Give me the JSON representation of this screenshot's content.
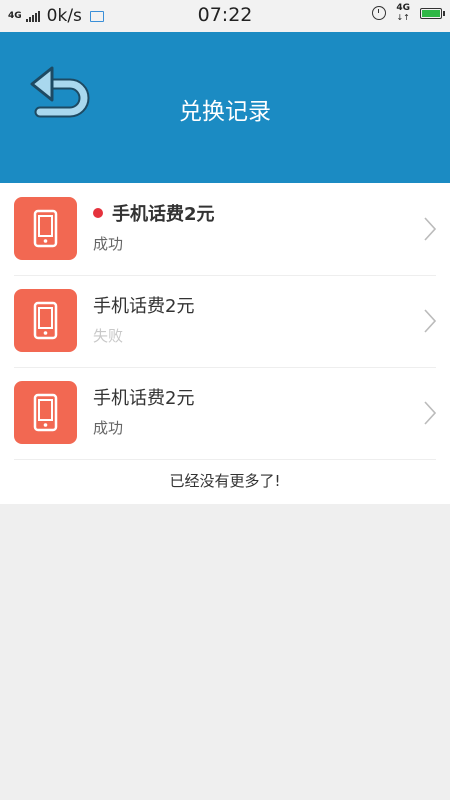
{
  "status_bar": {
    "network_left": "4G",
    "speed": "0k/s",
    "time": "07:22",
    "network_right": "4G"
  },
  "header": {
    "title": "兑换记录",
    "background": "#1b8bc3"
  },
  "records": [
    {
      "title": "手机话费2元",
      "status": "成功",
      "unread": true,
      "icon": "phone-icon"
    },
    {
      "title": "手机话费2元",
      "status": "失败",
      "unread": false,
      "icon": "phone-icon"
    },
    {
      "title": "手机话费2元",
      "status": "成功",
      "unread": false,
      "icon": "phone-icon"
    }
  ],
  "footer_note": "已经没有更多了!",
  "colors": {
    "accent": "#1b8bc3",
    "icon_bg": "#f26852",
    "unread_dot": "#e5323c"
  }
}
